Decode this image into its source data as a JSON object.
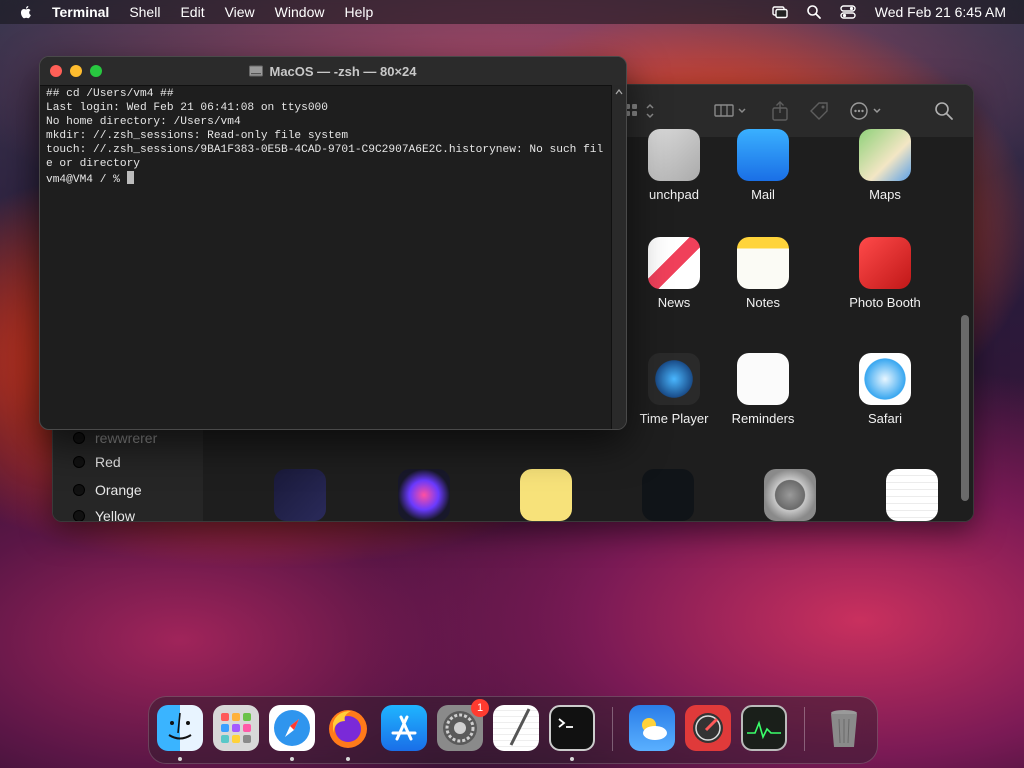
{
  "menubar": {
    "app_name": "Terminal",
    "items": [
      "Shell",
      "Edit",
      "View",
      "Window",
      "Help"
    ],
    "clock": "Wed Feb 21  6:45 AM"
  },
  "terminal": {
    "title": "MacOS — -zsh — 80×24",
    "lines": [
      "## cd /Users/vm4 ##",
      "Last login: Wed Feb 21 06:41:08 on ttys000",
      "No home directory: /Users/vm4",
      "mkdir: //.zsh_sessions: Read-only file system",
      "touch: //.zsh_sessions/9BA1F383-0E5B-4CAD-9701-C9C2907A6E2C.historynew: No such file or directory",
      "vm4@VM4 / % "
    ]
  },
  "finder": {
    "tags": [
      "rewwrerer",
      "Red",
      "Orange",
      "Yellow"
    ],
    "apps_row1": [
      "unchpad",
      "Mail",
      "Maps"
    ],
    "apps_row2": [
      "News",
      "Notes",
      "Photo Booth"
    ],
    "apps_row3": [
      "Time Player",
      "Reminders",
      "Safari"
    ]
  },
  "dock": {
    "apps": [
      "Finder",
      "Launchpad",
      "Safari",
      "Firefox",
      "App Store",
      "System Settings",
      "TextEdit",
      "Terminal",
      "Weather",
      "Directory Utility",
      "Activity Monitor",
      "Trash"
    ],
    "settings_badge": "1"
  },
  "colors": {
    "terminal_bg": "#1e1e1e",
    "close": "#ff5f57",
    "minimize": "#febc2e",
    "zoom": "#28c840",
    "badge": "#ff3b30"
  }
}
